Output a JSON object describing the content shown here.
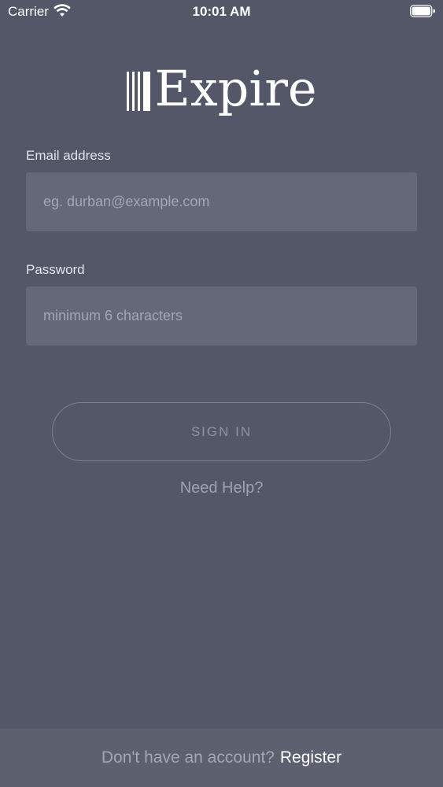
{
  "status_bar": {
    "carrier": "Carrier",
    "time": "10:01 AM",
    "wifi_icon": "wifi-icon",
    "battery_icon": "battery-icon"
  },
  "logo": {
    "text": "Expire",
    "mark_icon": "barcode-lines-icon"
  },
  "form": {
    "email": {
      "label": "Email address",
      "placeholder": "eg. durban@example.com",
      "value": ""
    },
    "password": {
      "label": "Password",
      "placeholder": "minimum 6 characters",
      "value": ""
    },
    "signin_label": "SIGN IN",
    "help_label": "Need Help?"
  },
  "footer": {
    "prompt": "Don't have an account?",
    "register_label": "Register"
  },
  "colors": {
    "background": "#535767",
    "input_background": "#656878",
    "footer_background": "#5c606f"
  }
}
